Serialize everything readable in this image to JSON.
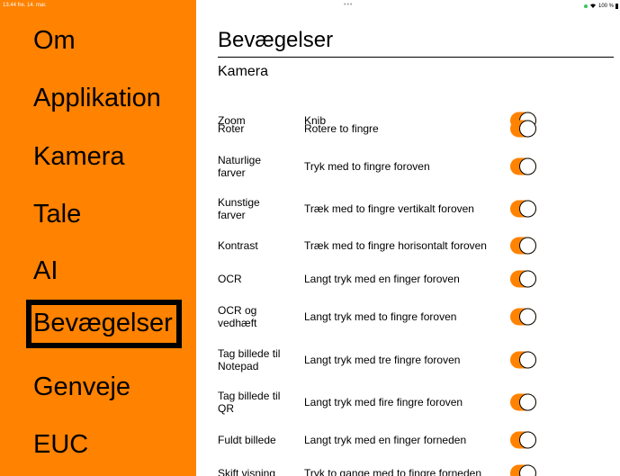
{
  "status_bar": {
    "time_date": "13.44  fre. 14. mar.",
    "dots": "•••",
    "battery": "100 %"
  },
  "sidebar": {
    "items": [
      {
        "label": "Om"
      },
      {
        "label": "Applikation"
      },
      {
        "label": "Kamera"
      },
      {
        "label": "Tale"
      },
      {
        "label": "AI"
      },
      {
        "label": "Bevægelser",
        "selected": true
      },
      {
        "label": "Genveje"
      },
      {
        "label": "EUC"
      }
    ]
  },
  "main": {
    "title": "Bevægelser",
    "section": "Kamera",
    "rows": [
      {
        "gesture": "Zoom",
        "action": "Knib",
        "enabled": true
      },
      {
        "gesture": "Roter",
        "action": "Rotere to fingre",
        "enabled": true
      },
      {
        "gesture": "Naturlige farver",
        "action": "Tryk med to fingre foroven",
        "enabled": true
      },
      {
        "gesture": "Kunstige farver",
        "action": "Træk med to fingre vertikalt foroven",
        "enabled": true
      },
      {
        "gesture": "Kontrast",
        "action": "Træk med to fingre horisontalt foroven",
        "enabled": true
      },
      {
        "gesture": "OCR",
        "action": "Langt tryk med en finger foroven",
        "enabled": true
      },
      {
        "gesture": "OCR og vedhæft",
        "action": "Langt tryk med to fingre foroven",
        "enabled": true
      },
      {
        "gesture": "Tag billede til Notepad",
        "action": "Langt tryk med tre fingre foroven",
        "enabled": true
      },
      {
        "gesture": "Tag billede til QR",
        "action": "Langt tryk med fire fingre foroven",
        "enabled": true
      },
      {
        "gesture": "Fuldt billede",
        "action": "Langt tryk med en finger forneden",
        "enabled": true
      },
      {
        "gesture": "Skift visning",
        "action": "Tryk to gange med to fingre forneden",
        "enabled": true
      }
    ]
  },
  "colors": {
    "accent": "#ff8200",
    "toggle_on": "#ff8200",
    "battery_dot": "#34c759"
  }
}
